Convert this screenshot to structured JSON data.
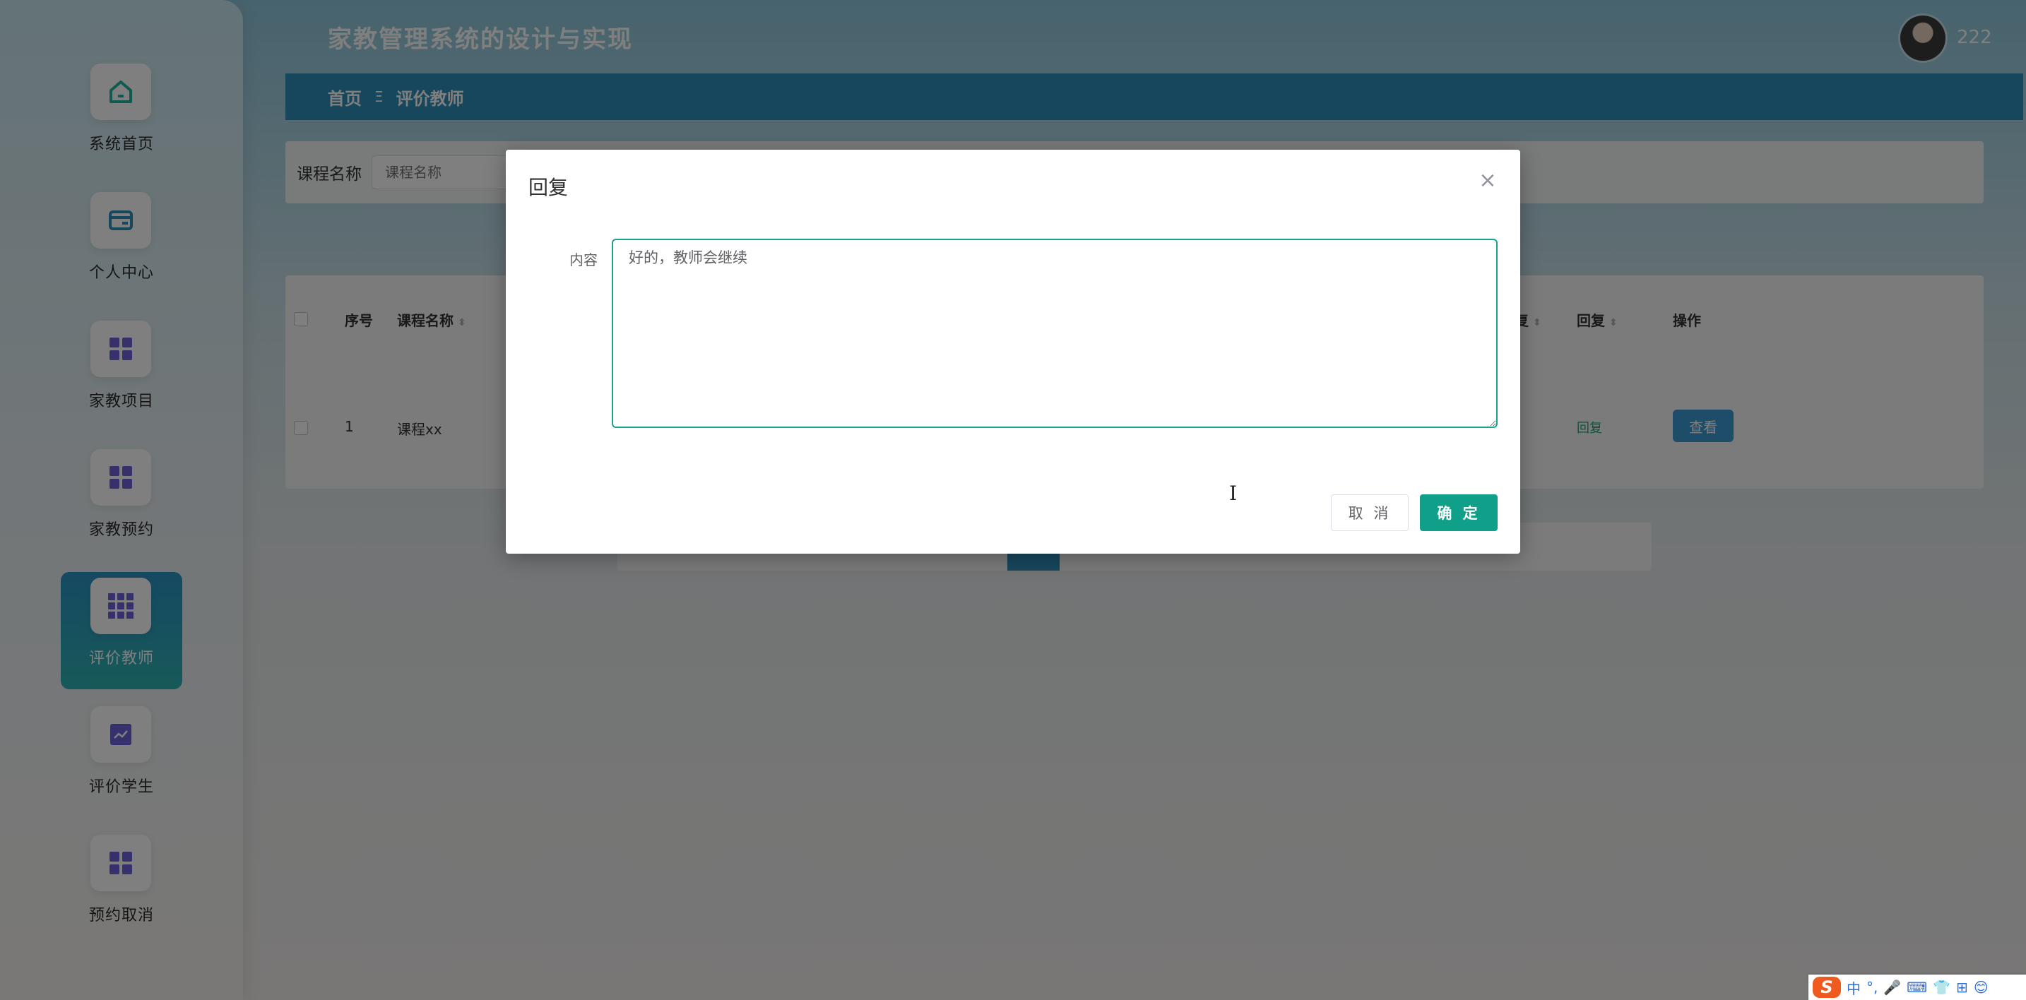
{
  "app": {
    "title": "家教管理系统的设计与实现",
    "username": "222"
  },
  "sidebar": {
    "items": [
      {
        "label": "系统首页",
        "icon": "home-icon"
      },
      {
        "label": "个人中心",
        "icon": "card-icon"
      },
      {
        "label": "家教项目",
        "icon": "grid-icon"
      },
      {
        "label": "家教预约",
        "icon": "grid-icon"
      },
      {
        "label": "评价教师",
        "icon": "grid9-icon",
        "active": true
      },
      {
        "label": "评价学生",
        "icon": "chart-icon"
      },
      {
        "label": "预约取消",
        "icon": "grid-icon"
      }
    ]
  },
  "breadcrumb": {
    "home": "首页",
    "separator": "Ξ",
    "current": "评价教师"
  },
  "search": {
    "label": "课程名称",
    "placeholder": "课程名称"
  },
  "table": {
    "headers": {
      "index": "序号",
      "course": "课程名称",
      "partial_reply": "复",
      "reply": "回复",
      "actions": "操作"
    },
    "rows": [
      {
        "index": "1",
        "course": "课程xx",
        "reply_link": "回复",
        "view_label": "查看"
      }
    ]
  },
  "modal": {
    "title": "回复",
    "close": "×",
    "content_label": "内容",
    "content_value": "好的，教师会继续",
    "cancel_label": "取 消",
    "confirm_label": "确 定"
  },
  "ime": {
    "logo": "S",
    "items": [
      "中",
      "°,",
      "🎤",
      "⌨",
      "👕",
      "⊞",
      "😊"
    ]
  },
  "colors": {
    "primary": "#10a08a",
    "header": "#2f8fba",
    "accent": "#6c63d9"
  }
}
